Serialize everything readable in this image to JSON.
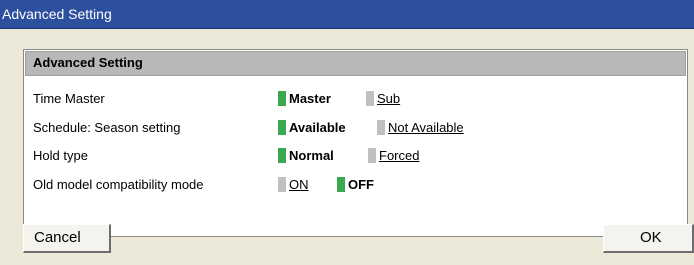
{
  "window": {
    "title": "Advanced Setting"
  },
  "panel": {
    "title": "Advanced Setting",
    "rows": [
      {
        "label": "Time Master",
        "options": [
          {
            "label": "Master",
            "selected": true
          },
          {
            "label": "Sub",
            "selected": false
          }
        ]
      },
      {
        "label": "Schedule: Season setting",
        "options": [
          {
            "label": "Available",
            "selected": true
          },
          {
            "label": "Not Available",
            "selected": false
          }
        ]
      },
      {
        "label": "Hold type",
        "options": [
          {
            "label": "Normal",
            "selected": true
          },
          {
            "label": "Forced",
            "selected": false
          }
        ]
      },
      {
        "label": "Old model compatibility mode",
        "options": [
          {
            "label": "ON",
            "selected": false
          },
          {
            "label": "OFF",
            "selected": true
          }
        ]
      }
    ]
  },
  "buttons": {
    "cancel": "Cancel",
    "ok": "OK"
  },
  "colors": {
    "titlebar": "#2c4f9e",
    "selected_indicator": "#3aa84f",
    "unselected_indicator": "#bfbfbf",
    "panel_header": "#b8b8b8",
    "window_background": "#ece9d8"
  }
}
